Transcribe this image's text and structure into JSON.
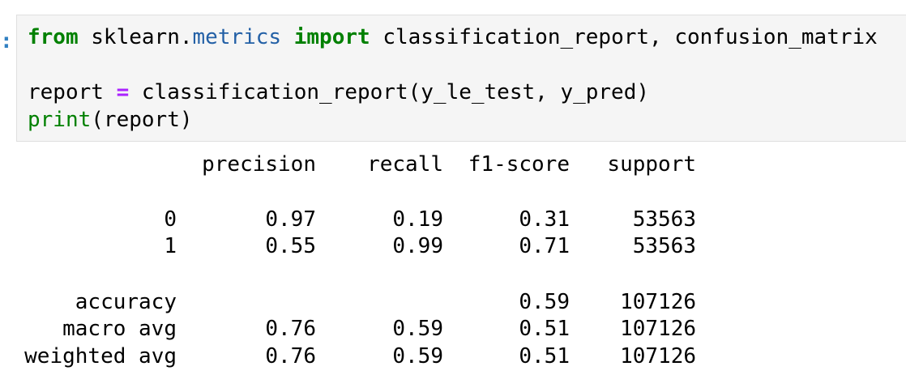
{
  "cell": {
    "prompt": ":",
    "code_lines": [
      {
        "tokens": [
          {
            "text": "from",
            "type": "kw"
          },
          {
            "text": " sklearn.",
            "type": "text"
          },
          {
            "text": "metrics",
            "type": "mod"
          },
          {
            "text": " ",
            "type": "text"
          },
          {
            "text": "import",
            "type": "kw"
          },
          {
            "text": " classification_report, confusion_matrix",
            "type": "text"
          }
        ]
      },
      {
        "tokens": [
          {
            "text": "",
            "type": "text"
          }
        ]
      },
      {
        "tokens": [
          {
            "text": "report ",
            "type": "text"
          },
          {
            "text": "=",
            "type": "op"
          },
          {
            "text": " classification_report(y_le_test, y_pred)",
            "type": "text"
          }
        ]
      },
      {
        "tokens": [
          {
            "text": "print",
            "type": "builtin"
          },
          {
            "text": "(report)",
            "type": "text"
          }
        ]
      }
    ]
  },
  "output": {
    "header": [
      "precision",
      "recall",
      "f1-score",
      "support"
    ],
    "class_rows": [
      {
        "label": "0",
        "precision": "0.97",
        "recall": "0.19",
        "f1": "0.31",
        "support": "53563"
      },
      {
        "label": "1",
        "precision": "0.55",
        "recall": "0.99",
        "f1": "0.71",
        "support": "53563"
      }
    ],
    "summary_rows": [
      {
        "label": "accuracy",
        "precision": "",
        "recall": "",
        "f1": "0.59",
        "support": "107126"
      },
      {
        "label": "macro avg",
        "precision": "0.76",
        "recall": "0.59",
        "f1": "0.51",
        "support": "107126"
      },
      {
        "label": "weighted avg",
        "precision": "0.76",
        "recall": "0.59",
        "f1": "0.51",
        "support": "107126"
      }
    ]
  }
}
